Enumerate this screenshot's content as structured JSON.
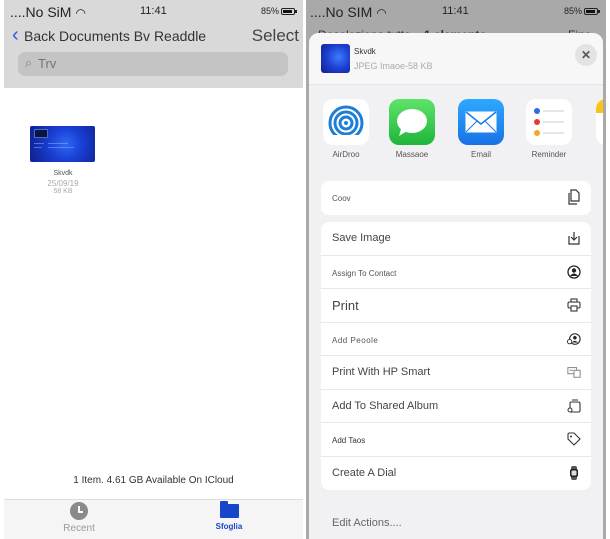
{
  "left": {
    "status": {
      "carrier": "....No SiM",
      "time": "11:41",
      "battery": "85%"
    },
    "nav": {
      "back_label": "Back Documents Bv Readdle",
      "select_label": "Select"
    },
    "search": {
      "placeholder": "Trv"
    },
    "file": {
      "name": "Skvdk",
      "date": "25/09/19",
      "size": "58 KB"
    },
    "footer_info": "1 Item. 4.61 GB Available On ICloud",
    "tabs": [
      {
        "label": "Recent",
        "icon": "clock-icon",
        "active": false
      },
      {
        "label": "Sfoglia",
        "icon": "folder-icon",
        "active": true
      }
    ],
    "colors": {
      "accent": "#1747c9"
    }
  },
  "right": {
    "status": {
      "carrier": "....No SIM",
      "time": "11:41",
      "battery": "85%"
    },
    "behind_nav": {
      "left": "Deseleziona tutto",
      "center": "1 elemento",
      "right": "Fine"
    },
    "sheet": {
      "title": "Skvdk",
      "subtitle": "JPEG Imaoe-58 KB",
      "close_icon": "close-icon",
      "apps": [
        {
          "label": "AirDroo",
          "icon": "airdrop-icon"
        },
        {
          "label": "Massaoe",
          "icon": "message-icon"
        },
        {
          "label": "Email",
          "icon": "mail-icon"
        },
        {
          "label": "Reminder",
          "icon": "reminders-icon"
        },
        {
          "label": "",
          "icon": "notes-icon"
        }
      ],
      "copy_group": [
        {
          "label": "Coov",
          "icon": "copy-icon"
        }
      ],
      "actions": [
        {
          "label": "Save Image",
          "icon": "save-image-icon"
        },
        {
          "label": "Assign To Contact",
          "icon": "contact-icon"
        },
        {
          "label": "Print",
          "icon": "printer-icon"
        },
        {
          "label": "Add Peoole",
          "icon": "add-people-icon"
        },
        {
          "label": "Print With HP Smart",
          "icon": "hp-smart-icon"
        },
        {
          "label": "Add To Shared Album",
          "icon": "shared-album-icon"
        },
        {
          "label": "Add Taos",
          "icon": "tag-icon"
        },
        {
          "label": "Create A Dial",
          "icon": "watch-icon"
        }
      ],
      "edit_actions": "Edit Actions...."
    }
  }
}
